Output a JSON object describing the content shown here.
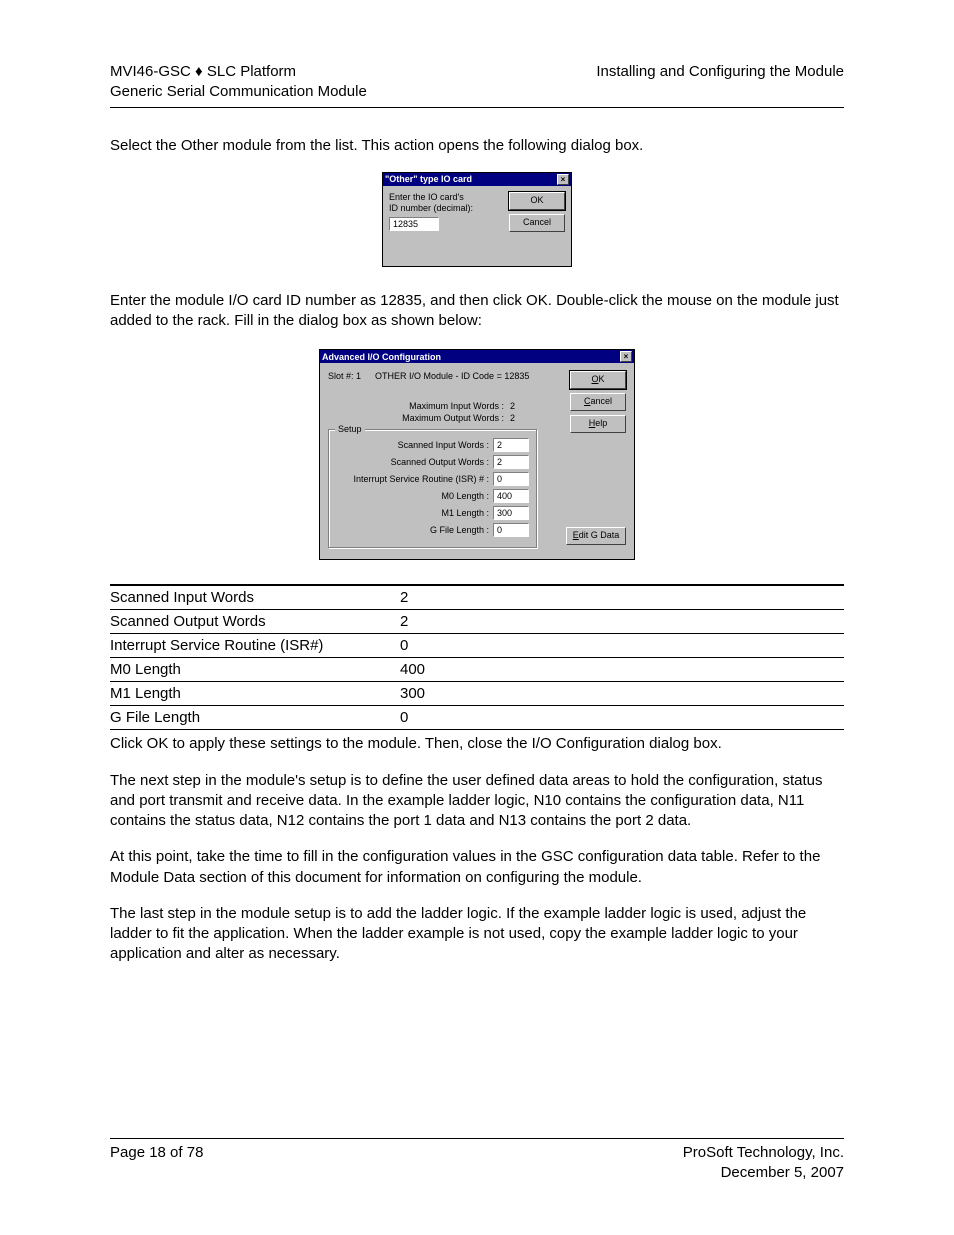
{
  "header": {
    "left_line1": "MVI46-GSC ♦ SLC Platform",
    "left_line2": "Generic Serial Communication Module",
    "right_line1": "Installing and Configuring the Module"
  },
  "para1": "Select the Other module from the list. This action opens the following dialog box.",
  "dialog1": {
    "title": "\"Other\" type IO card",
    "close": "×",
    "label1": "Enter the IO card's",
    "label2": "ID number (decimal):",
    "value": "12835",
    "ok": "OK",
    "cancel": "Cancel"
  },
  "para2": "Enter the module I/O card ID number as 12835, and then click OK. Double-click the mouse on the module just added to the rack. Fill in the dialog box as shown below:",
  "dialog2": {
    "title": "Advanced I/O Configuration",
    "close": "×",
    "slot_label": "Slot #: 1",
    "slot_desc": "OTHER I/O Module - ID Code = 12835",
    "max_in_label": "Maximum Input Words :",
    "max_in_val": "2",
    "max_out_label": "Maximum Output Words :",
    "max_out_val": "2",
    "setup_legend": "Setup",
    "f_scanned_in": "Scanned Input Words :",
    "v_scanned_in": "2",
    "f_scanned_out": "Scanned Output Words :",
    "v_scanned_out": "2",
    "f_isr": "Interrupt Service Routine (ISR) # :",
    "v_isr": "0",
    "f_m0": "M0 Length :",
    "v_m0": "400",
    "f_m1": "M1 Length :",
    "v_m1": "300",
    "f_g": "G File Length :",
    "v_g": "0",
    "ok_u": "O",
    "ok_rest": "K",
    "cancel_u": "C",
    "cancel_rest": "ancel",
    "help_u": "H",
    "help_rest": "elp",
    "edit_u": "E",
    "edit_rest": "dit G Data"
  },
  "table": [
    {
      "label": "Scanned Input Words",
      "value": "2"
    },
    {
      "label": "Scanned Output Words",
      "value": "2"
    },
    {
      "label": "Interrupt Service Routine (ISR#)",
      "value": "0"
    },
    {
      "label": "M0 Length",
      "value": "400"
    },
    {
      "label": "M1 Length",
      "value": "300"
    },
    {
      "label": "G File Length",
      "value": "0"
    }
  ],
  "para3": "Click OK to apply these settings to the module. Then, close the I/O Configuration dialog box.",
  "para4": "The next step in the module's setup is to define the user defined data areas to hold the configuration, status and port transmit and receive data. In the example ladder logic, N10 contains the configuration data, N11 contains the status data, N12 contains the port 1 data and N13 contains the port 2 data.",
  "para5": "At this point, take the time to fill in the configuration values in the GSC configuration data table. Refer to the Module Data section of this document for information on configuring the module.",
  "para6": "The last step in the module setup is to add the ladder logic. If the example ladder logic is used, adjust the ladder to fit the application. When the ladder example is not used, copy the example ladder logic to your application and alter as necessary.",
  "footer": {
    "left": "Page 18 of 78",
    "right1": "ProSoft Technology, Inc.",
    "right2": "December 5, 2007"
  }
}
